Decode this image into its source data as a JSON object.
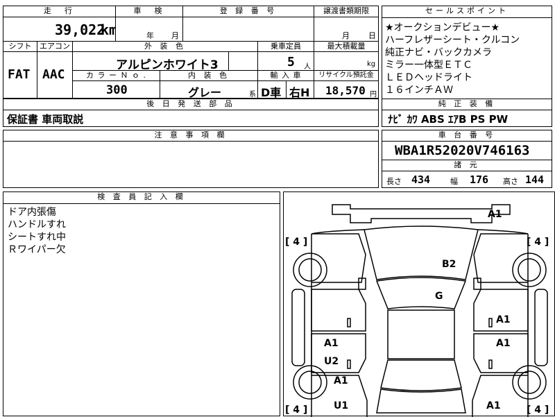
{
  "top": {
    "labels": {
      "mileage": "走　行",
      "inspection": "車　検",
      "registration": "登 録 番 号",
      "transfer_deadline": "譲渡書類期限",
      "sales_points": "セールスポイント",
      "shift": "シフト",
      "aircon": "エアコン",
      "exterior_color": "外 装 色",
      "capacity": "乗車定員",
      "max_load": "最大積載量",
      "color_no": "カ ラ ー Ｎ ｏ .",
      "interior_color": "内 装 色",
      "import": "輸 入 車",
      "recycle": "リサイクル預託金",
      "later_parts": "後 日 発 送 部 品",
      "equipment": "純 正 装 備",
      "notes": "注 意 事 項 欄",
      "chassis_no": "車 台 番 号",
      "specs": "諸 元",
      "inspector": "検 査 員 記 入 欄"
    },
    "mileage_value": "39,022",
    "mileage_unit": "km",
    "inspection_year": "年",
    "inspection_month": "月",
    "deadline_month": "月",
    "deadline_day": "日",
    "shift_value": "FAT",
    "aircon_value": "AAC",
    "exterior_color_value": "アルピンホワイト3",
    "capacity_value": "5",
    "capacity_unit": "人",
    "max_load_unit": "kg",
    "color_no_value": "300",
    "interior_color_value": "グレー",
    "interior_suffix": "系",
    "import_type": "D車",
    "handle": "右H",
    "recycle_value": "18,570",
    "recycle_unit": "円",
    "later_parts_value": "保証書 車両取説",
    "equipment_value": "ﾅﾋﾞ ｶﾜ ABS ｴｱB PS PW",
    "chassis_no_value": "WBA1R52020V746163",
    "spec_length_label": "長さ",
    "spec_length": "434",
    "spec_width_label": "幅",
    "spec_width": "176",
    "spec_height_label": "高さ",
    "spec_height": "144"
  },
  "sales_points": [
    "★オークションデビュー★",
    "ハーフレザーシート・クルコン",
    "純正ナビ・バックカメラ",
    "ミラー一体型ＥＴＣ",
    "ＬＥＤヘッドライト",
    "１６インチＡＷ"
  ],
  "inspector_notes": [
    "ドア内張傷",
    "ハンドルすれ",
    "シートすれ中",
    "Ｒワイパー欠"
  ],
  "diagram": {
    "tire_labels": [
      "[ 4 ]",
      "[ 4 ]",
      "[ 4 ]",
      "[ 4 ]"
    ],
    "damage": {
      "front_bumper": "A1",
      "bonnet": "B2",
      "roof": "G",
      "right_front_door": "A1",
      "right_rear_door": "A1",
      "left_rear_door_a": "A1",
      "left_rear_door_u": "U2",
      "left_rear_fender": "A1",
      "rear_left": "U1",
      "rear_right": "A1"
    }
  }
}
